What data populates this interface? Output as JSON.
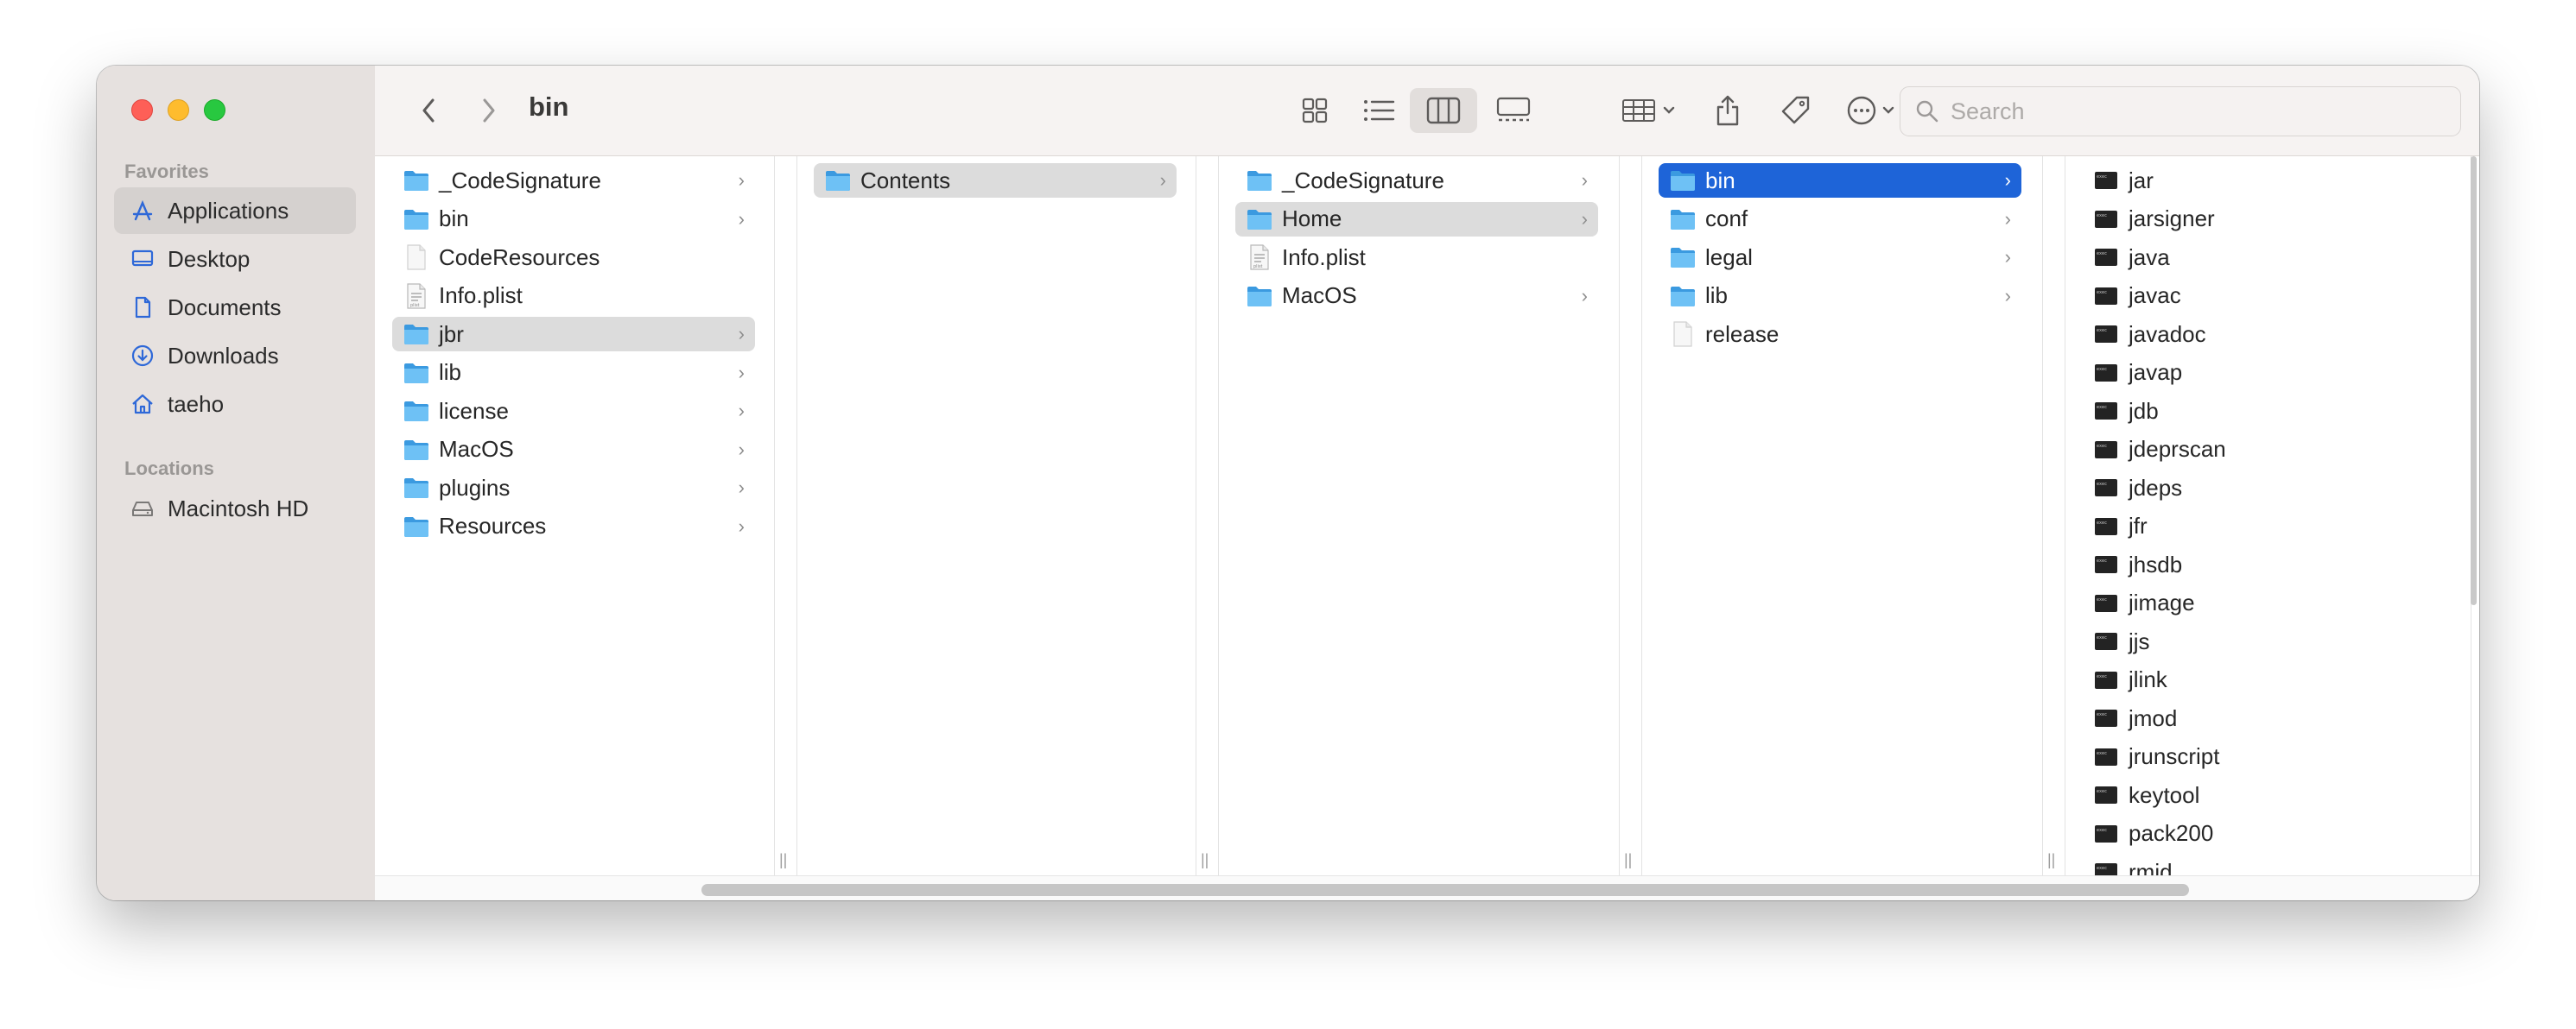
{
  "window": {
    "title": "bin"
  },
  "sidebar": {
    "favorites_label": "Favorites",
    "favorites": [
      {
        "label": "Applications",
        "icon": "applications-icon",
        "selected": true
      },
      {
        "label": "Desktop",
        "icon": "desktop-icon"
      },
      {
        "label": "Documents",
        "icon": "document-icon"
      },
      {
        "label": "Downloads",
        "icon": "downloads-icon"
      },
      {
        "label": "taeho",
        "icon": "home-icon"
      }
    ],
    "locations_label": "Locations",
    "locations": [
      {
        "label": "Macintosh HD",
        "icon": "disk-icon"
      }
    ]
  },
  "toolbar": {
    "back": "back-icon",
    "forward": "forward-icon",
    "views": [
      "icon-view",
      "list-view",
      "column-view",
      "gallery-view"
    ],
    "active_view": "column-view",
    "search_placeholder": "Search"
  },
  "columns": [
    {
      "items": [
        {
          "name": "_CodeSignature",
          "type": "folder",
          "chevron": true
        },
        {
          "name": "bin",
          "type": "folder",
          "chevron": true
        },
        {
          "name": "CodeResources",
          "type": "file",
          "chevron": false
        },
        {
          "name": "Info.plist",
          "type": "plist",
          "chevron": false
        },
        {
          "name": "jbr",
          "type": "folder",
          "chevron": true,
          "selected": "gray"
        },
        {
          "name": "lib",
          "type": "folder",
          "chevron": true
        },
        {
          "name": "license",
          "type": "folder",
          "chevron": true
        },
        {
          "name": "MacOS",
          "type": "folder",
          "chevron": true
        },
        {
          "name": "plugins",
          "type": "folder",
          "chevron": true
        },
        {
          "name": "Resources",
          "type": "folder",
          "chevron": true
        }
      ]
    },
    {
      "items": [
        {
          "name": "Contents",
          "type": "folder",
          "chevron": true,
          "selected": "gray"
        }
      ]
    },
    {
      "items": [
        {
          "name": "_CodeSignature",
          "type": "folder",
          "chevron": true
        },
        {
          "name": "Home",
          "type": "folder",
          "chevron": true,
          "selected": "gray"
        },
        {
          "name": "Info.plist",
          "type": "plist",
          "chevron": false
        },
        {
          "name": "MacOS",
          "type": "folder",
          "chevron": true
        }
      ]
    },
    {
      "items": [
        {
          "name": "bin",
          "type": "folder",
          "chevron": true,
          "selected": "blue"
        },
        {
          "name": "conf",
          "type": "folder",
          "chevron": true
        },
        {
          "name": "legal",
          "type": "folder",
          "chevron": true
        },
        {
          "name": "lib",
          "type": "folder",
          "chevron": true
        },
        {
          "name": "release",
          "type": "file",
          "chevron": false
        }
      ]
    },
    {
      "items": [
        {
          "name": "jar",
          "type": "exec"
        },
        {
          "name": "jarsigner",
          "type": "exec"
        },
        {
          "name": "java",
          "type": "exec"
        },
        {
          "name": "javac",
          "type": "exec"
        },
        {
          "name": "javadoc",
          "type": "exec"
        },
        {
          "name": "javap",
          "type": "exec"
        },
        {
          "name": "jdb",
          "type": "exec"
        },
        {
          "name": "jdeprscan",
          "type": "exec"
        },
        {
          "name": "jdeps",
          "type": "exec"
        },
        {
          "name": "jfr",
          "type": "exec"
        },
        {
          "name": "jhsdb",
          "type": "exec"
        },
        {
          "name": "jimage",
          "type": "exec"
        },
        {
          "name": "jjs",
          "type": "exec"
        },
        {
          "name": "jlink",
          "type": "exec"
        },
        {
          "name": "jmod",
          "type": "exec"
        },
        {
          "name": "jrunscript",
          "type": "exec"
        },
        {
          "name": "keytool",
          "type": "exec"
        },
        {
          "name": "pack200",
          "type": "exec"
        },
        {
          "name": "rmid",
          "type": "exec"
        }
      ]
    }
  ]
}
